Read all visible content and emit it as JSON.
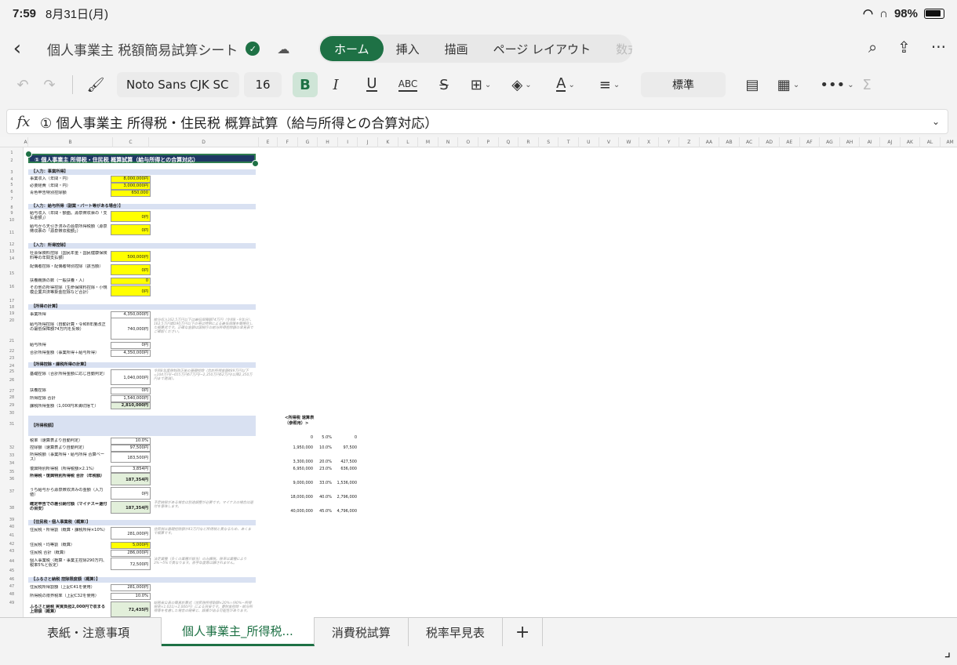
{
  "status": {
    "time": "7:59",
    "date": "8月31日(月)",
    "battery": "98%"
  },
  "app": {
    "title": "個人事業主 税額簡易試算シート",
    "tabs": [
      "ホーム",
      "挿入",
      "描画",
      "ページ レイアウト",
      "数式"
    ]
  },
  "toolbar": {
    "font_name": "Noto Sans CJK SC",
    "font_size": "16",
    "bold": "B",
    "italic": "I",
    "underline": "U",
    "abc": "ABC",
    "strike": "S",
    "number_format": "標準"
  },
  "formula_bar": {
    "fx": "fx",
    "content": "① 個人事業主 所得税・住民税 概算試算（給与所得との合算対応）"
  },
  "sheet": {
    "columns": [
      "A",
      "B",
      "C",
      "D",
      "E",
      "F",
      "G",
      "H",
      "I",
      "J",
      "K",
      "L",
      "M",
      "N",
      "O",
      "P",
      "Q",
      "R",
      "S",
      "T",
      "U",
      "V",
      "W",
      "X",
      "Y",
      "Z",
      "AA",
      "AB",
      "AC",
      "AD",
      "AE",
      "AF",
      "AG",
      "AH",
      "AI",
      "AJ",
      "AK",
      "AL",
      "AM"
    ],
    "rows": [
      "1",
      "2",
      "3",
      "4",
      "5",
      "6",
      "7",
      "8",
      "9",
      "10",
      "11",
      "12",
      "13",
      "14",
      "15",
      "16",
      "17",
      "18",
      "19",
      "20",
      "21",
      "22",
      "23",
      "24",
      "25",
      "26",
      "27",
      "28",
      "29",
      "30",
      "31",
      "32",
      "33",
      "34",
      "35",
      "36",
      "37",
      "38",
      "39",
      "40",
      "41",
      "42",
      "43",
      "44",
      "45",
      "46",
      "47",
      "48",
      "49"
    ],
    "title_cell": "① 個人事業主 所得税・住民税 概算試算（給与所得との合算対応）",
    "sections": {
      "s1": "【入力：事業所得】",
      "s2": "【入力：給与所得（副業・パート等がある場合）】",
      "s3": "【入力：所得控除】",
      "s4": "【所得の計算】",
      "s5": "【所得控除・課税所得の計算】",
      "s6": "【所得税額】",
      "s7": "【住民税・個人事業税（概算）】",
      "s8": "【ふるさと納税 控除限度額（概算）】"
    },
    "items": [
      {
        "label": "事業収入（年間・円）",
        "value": "8,000,000円"
      },
      {
        "label": "必要経費（年間・円）",
        "value": "3,000,000円"
      },
      {
        "label": "青色申告特別控除額",
        "value": "650,000"
      },
      {
        "label": "給与収入（年間・額面。源泉徴収票の「支払金額」）",
        "value": "0円"
      },
      {
        "label": "給与から天引き済みの源泉所得税額（源泉徴収票の「源泉徴収税額」）",
        "value": "0円"
      },
      {
        "label": "社会保険料控除（国民年金・国民健康保険料等の年間支払額）",
        "value": "500,000円"
      },
      {
        "label": "配偶者控除・配偶者特別控除（該当額）",
        "value": "0円"
      },
      {
        "label": "扶養親族の数（一般扶養・人）",
        "value": "0"
      },
      {
        "label": "その他の所得控除（生命保険料控除・小規模企業共済等掛金控除など合計）",
        "value": "0円"
      },
      {
        "label": "事業所得",
        "value": "4,350,000円"
      },
      {
        "label": "給与所得控除（自動計算・令和8年度改正の最低保障額74万円を反映）",
        "value": "740,000円"
      },
      {
        "label": "給与所得",
        "value": "0円"
      },
      {
        "label": "合計所得金額（事業所得＋給与所得）",
        "value": "4,350,000円"
      },
      {
        "label": "基礎控除（合計所得金額に応じ自動判定）",
        "value": "1,040,000円"
      },
      {
        "label": "扶養控除",
        "value": "0円"
      },
      {
        "label": "所得控除 合計",
        "value": "1,540,000円"
      },
      {
        "label": "課税所得金額（1,000円未満切捨て）",
        "value": "2,810,000円"
      },
      {
        "label": "税率（速算表より自動判定）",
        "value": "10.0%"
      },
      {
        "label": "控除額（速算表より自動判定）",
        "value": "97,500円"
      },
      {
        "label": "所得税額（事業所得・給与所得 合算ベース）",
        "value": "183,500円"
      },
      {
        "label": "復興特別所得税（所得税額×2.1%）",
        "value": "3,854円"
      },
      {
        "label": "所得税・復興特別所得税 合計（年税額）",
        "value": "187,354円"
      },
      {
        "label": "うち給与から源泉徴収済みの金額（入力値）",
        "value": "0円"
      },
      {
        "label": "確定申告での差引納付額（マイナス＝還付の目安）",
        "value": "187,354円"
      },
      {
        "label": "住民税・所得割（概算・課税所得×10%）",
        "value": "281,000円"
      },
      {
        "label": "住民税・均等割（概算）",
        "value": "5,000円"
      },
      {
        "label": "住民税 合計（概算）",
        "value": "286,000円"
      },
      {
        "label": "個人事業税（概算・事業主控除290万円、税率5%と仮定）",
        "value": "72,500円"
      },
      {
        "label": "住民税所得割額（上記C41を使用）",
        "value": "281,000円"
      },
      {
        "label": "所得税の限界税率（上記C32を使用）",
        "value": "10.0%"
      },
      {
        "label": "ふるさと納税 実質負担2,000円で収まる上限額（概算）",
        "value": "72,435円"
      }
    ],
    "notes": {
      "n1": "給与収入162.5万円以下は最低保障額74万円（令和8・9年分）、162.5万円超190万円以下の帯は特例による最低保障を簡略化した概算式です。正確な金額は国税庁の給与所得控除額の早見表でご確認ください。",
      "n2": "令和8年度税制改正後の基礎控除（合計所得金額489万円以下=104万円/~655万円67万円/~2,350万円62万円/以降2,350万円まで逓減）。",
      "n3": "予定納税がある場合は別途調整が必要です。マイナスの場合は還付を意味します。",
      "n4": "住民税は基礎控除額が43万円など所得税と異なるため、あくまで概算です。",
      "n5": "法定業種（多くの業種が該当）のみ課税。税率は業種により3%〜5%で異なります。赤字年度等は課されません。",
      "n6": "総務省公表の簡易計算式（住民税所得割額×20%÷(90%−所得税率×1.021)+2,000円）による目安です。寄附金控除・給与所得等を考慮した場合の結果と、誤差が出る可能性があります。"
    },
    "rate_table": {
      "label": "<所得税 速算表（参照用）>",
      "rows": [
        [
          "0",
          "5.0%",
          "0"
        ],
        [
          "1,950,000",
          "10.0%",
          "97,500"
        ],
        [
          "3,300,000",
          "20.0%",
          "427,500"
        ],
        [
          "6,950,000",
          "23.0%",
          "636,000"
        ],
        [
          "9,000,000",
          "33.0%",
          "1,536,000"
        ],
        [
          "18,000,000",
          "40.0%",
          "2,796,000"
        ],
        [
          "40,000,000",
          "45.0%",
          "4,796,000"
        ]
      ]
    }
  },
  "sheet_tabs": [
    "表紙・注意事項",
    "個人事業主_所得税...",
    "消費税試算",
    "税率早見表",
    "+"
  ]
}
